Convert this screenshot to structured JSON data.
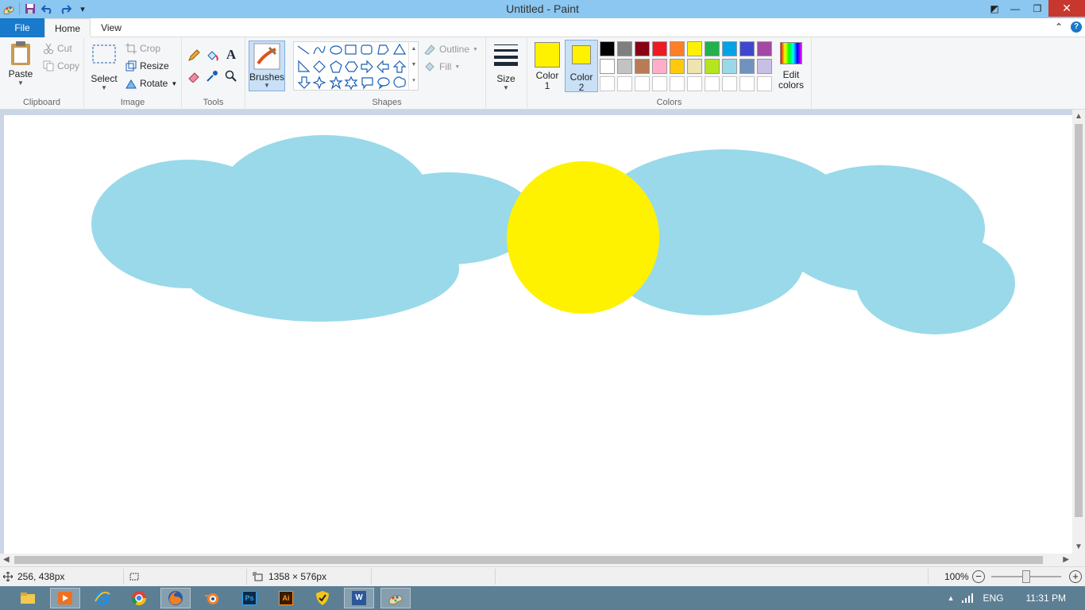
{
  "window": {
    "title": "Untitled - Paint",
    "minimize_glyph": "—",
    "restore_glyph": "❐",
    "close_glyph": "✕",
    "helpmode_glyph": "◩"
  },
  "qat": {
    "customize_glyph": "▾"
  },
  "tabs": {
    "file": "File",
    "home": "Home",
    "view": "View",
    "collapse_glyph": "⌃",
    "help_glyph": "?"
  },
  "clipboard": {
    "paste": "Paste",
    "cut": "Cut",
    "copy": "Copy",
    "label": "Clipboard"
  },
  "image": {
    "select": "Select",
    "crop": "Crop",
    "resize": "Resize",
    "rotate": "Rotate",
    "label": "Image"
  },
  "tools": {
    "label": "Tools"
  },
  "brushes": {
    "label": "Brushes"
  },
  "shapes": {
    "outline": "Outline",
    "fill": "Fill",
    "label": "Shapes"
  },
  "size": {
    "label": "Size"
  },
  "colors": {
    "color1_line1": "Color",
    "color1_line2": "1",
    "color2_line1": "Color",
    "color2_line2": "2",
    "color1_value": "#fff200",
    "color2_value": "#fff200",
    "edit_line1": "Edit",
    "edit_line2": "colors",
    "label": "Colors",
    "palette_row1": [
      "#000000",
      "#7f7f7f",
      "#880015",
      "#ed1c24",
      "#ff7f27",
      "#fff200",
      "#22b14c",
      "#00a2e8",
      "#3f48cc",
      "#a349a4"
    ],
    "palette_row2": [
      "#ffffff",
      "#c3c3c3",
      "#b97a57",
      "#ffaec9",
      "#ffc90e",
      "#efe4b0",
      "#b5e61d",
      "#99d9ea",
      "#7092be",
      "#c8bfe7"
    ]
  },
  "canvas": {
    "cloud_color": "#99d9ea",
    "sun_color": "#fff200"
  },
  "status": {
    "cursor_pos": "256, 438px",
    "canvas_size": "1358 × 576px",
    "zoom": "100%",
    "zoom_out_glyph": "−",
    "zoom_in_glyph": "+"
  },
  "taskbar": {
    "apps": [
      "file-explorer",
      "media-player",
      "internet-explorer",
      "chrome",
      "firefox",
      "blender",
      "photoshop",
      "illustrator",
      "norton",
      "word",
      "paint"
    ],
    "ps_text": "Ps",
    "ai_text": "Ai",
    "word_text": "W",
    "show_hidden_glyph": "▲",
    "lang": "ENG",
    "time": "11:31 PM"
  }
}
